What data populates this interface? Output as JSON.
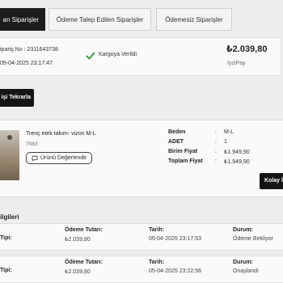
{
  "tabs": [
    {
      "label": "an Siparişler",
      "active": true
    },
    {
      "label": "Ödeme Talep Edilen Siparişler",
      "active": false
    },
    {
      "label": "Ödemesiz Siparişler",
      "active": false
    }
  ],
  "order": {
    "number_text": "ipariş No : 2311643738",
    "date": "05-04-2025 23:17:47",
    "status_icon": "check-icon",
    "status": "Kargoya Verildi",
    "total": "₺2.039,80",
    "payment_method": "IyziPay",
    "status_color": "#3a9b3a"
  },
  "reorder_button": "işi Tekrarla",
  "product": {
    "name": "Trenç etek takım- vizon M-L",
    "code": "7083",
    "review_button": "Ürünü Değerlendir",
    "specs": [
      {
        "label": "Beden",
        "value": "M-L"
      },
      {
        "label": "ADET",
        "value": "1"
      },
      {
        "label": "Birim Fiyat",
        "value": "₺1.949,90"
      },
      {
        "label": "Toplam Fiyat",
        "value": "₺1.949,90"
      }
    ],
    "easy_return_button": "Kolay İade"
  },
  "payments": {
    "section_title": "ilgileri",
    "type_label": "Tipi:",
    "amount_label": "Ödeme Tutarı:",
    "date_label": "Tarih:",
    "status_label": "Durum:",
    "rows": [
      {
        "amount": "₺2.039,80",
        "date": "05-04-2025 23:17:53",
        "status": "Ödeme Bekliyor"
      },
      {
        "amount": "₺2.039,80",
        "date": "05-04-2025 23:22:56",
        "status": "Onaylandı"
      }
    ]
  }
}
